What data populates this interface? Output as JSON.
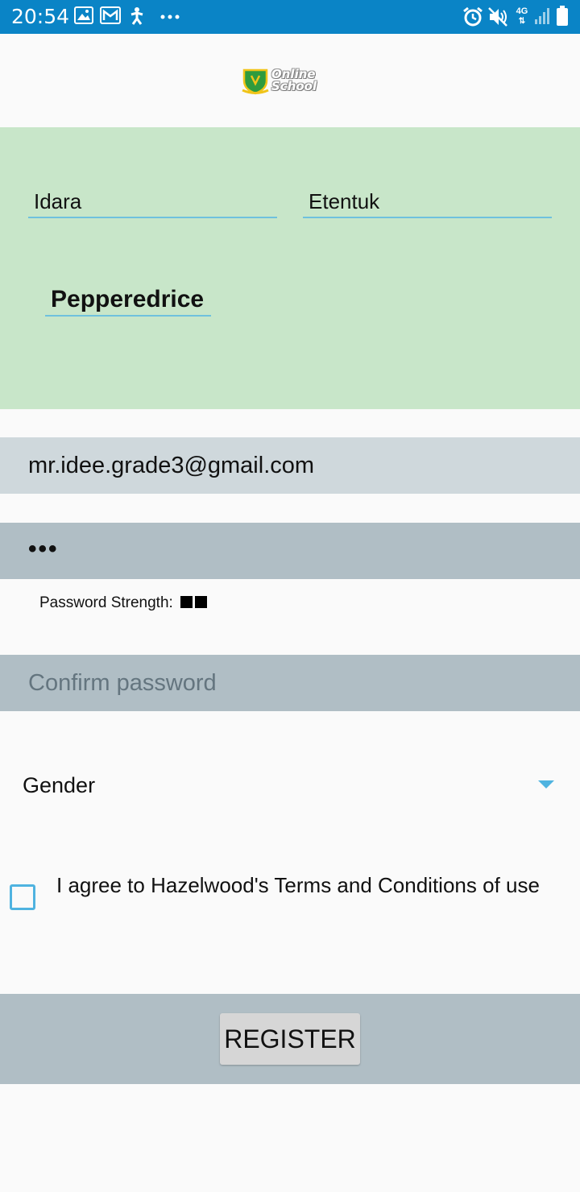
{
  "status_bar": {
    "time": "20:54",
    "left_icons": [
      "image-icon",
      "gmail-icon",
      "accessibility-icon",
      "more-dots-icon"
    ],
    "right_icons": [
      "alarm-icon",
      "mute-icon",
      "network-4g-icon",
      "signal-icon",
      "battery-icon"
    ],
    "network_label": "4G"
  },
  "header": {
    "logo_line1": "Online",
    "logo_line2": "School"
  },
  "name_section": {
    "first_name": "Idara",
    "last_name": "Etentuk",
    "nickname": "Pepperedrice",
    "background_color": "#c8e6c9",
    "underline_color": "#6fc1de"
  },
  "email": {
    "value": "mr.idee.grade3@gmail.com"
  },
  "password": {
    "value": "•••"
  },
  "password_strength": {
    "label": "Password Strength:",
    "blocks": 2
  },
  "confirm_password": {
    "placeholder": "Confirm password"
  },
  "gender": {
    "selected": "Gender"
  },
  "terms": {
    "label": "I agree to Hazelwood's Terms and Conditions of use",
    "checked": false
  },
  "register": {
    "label": "REGISTER"
  },
  "colors": {
    "status_bar": "#0a84c6",
    "accent": "#4fb3e0",
    "email_bar": "#cfd8dc",
    "password_bar": "#b0bec5"
  }
}
